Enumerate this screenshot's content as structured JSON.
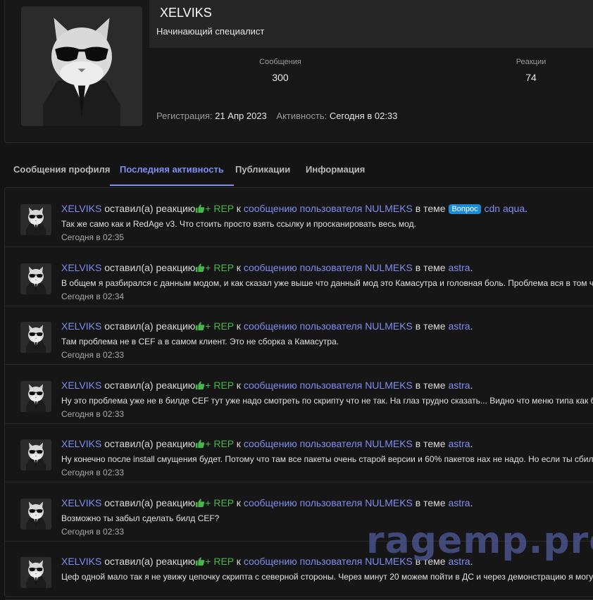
{
  "profile": {
    "username": "XELVIKS",
    "title": "Начинающий специалист",
    "stats": [
      {
        "label": "Сообщения",
        "value": "300"
      },
      {
        "label": "Реакции",
        "value": "74"
      }
    ],
    "registration_label": "Регистрация:",
    "registration_value": "21 Апр 2023",
    "activity_label": "Активность:",
    "activity_value": "Сегодня в 02:33"
  },
  "tabs": [
    {
      "label": "Сообщения профиля",
      "active": false
    },
    {
      "label": "Последняя активность",
      "active": true
    },
    {
      "label": "Публикации",
      "active": false
    },
    {
      "label": "Информация",
      "active": false
    }
  ],
  "feed": [
    {
      "user": "XELVIKS",
      "action": "оставил(а) реакцию",
      "rep": "+ REP",
      "k": "к",
      "target": "сообщению пользователя NULMEKS",
      "in_thread": "в теме",
      "prefix": "Вопрос",
      "thread": "cdn aqua",
      "snippet": "Так же само как и RedAge v3. Что стоить просто взять ссылку и просканировать весь мод.",
      "time": "Сегодня в 02:35"
    },
    {
      "user": "XELVIKS",
      "action": "оставил(а) реакцию",
      "rep": "+ REP",
      "k": "к",
      "target": "сообщению пользователя NULMEKS",
      "in_thread": "в теме",
      "prefix": "",
      "thread": "astra",
      "snippet": "В общем я разбирался с данным модом, и как сказал уже выше что данный мод это Камасутра и головная боль. Проблема вся в том что",
      "time": "Сегодня в 02:34"
    },
    {
      "user": "XELVIKS",
      "action": "оставил(а) реакцию",
      "rep": "+ REP",
      "k": "к",
      "target": "сообщению пользователя NULMEKS",
      "in_thread": "в теме",
      "prefix": "",
      "thread": "astra",
      "snippet": "Там проблема не в CEF а в самом клиент. Это не сборка а Камасутра.",
      "time": "Сегодня в 02:33"
    },
    {
      "user": "XELVIKS",
      "action": "оставил(а) реакцию",
      "rep": "+ REP",
      "k": "к",
      "target": "сообщению пользователя NULMEKS",
      "in_thread": "в теме",
      "prefix": "",
      "thread": "astra",
      "snippet": "Ну это проблема уже не в билде CEF тут уже надо смотреть по скрипту что не так. На глаз трудно сказать... Видно что меню типа как бы.",
      "time": "Сегодня в 02:33"
    },
    {
      "user": "XELVIKS",
      "action": "оставил(а) реакцию",
      "rep": "+ REP",
      "k": "к",
      "target": "сообщению пользователя NULMEKS",
      "in_thread": "в теме",
      "prefix": "",
      "thread": "astra",
      "snippet": "Ну конечно после install смущения будет. Потому что там все пакеты очень старой версии и 60% пакетов нах не надо. Но если ты сбилди",
      "time": "Сегодня в 02:33"
    },
    {
      "user": "XELVIKS",
      "action": "оставил(а) реакцию",
      "rep": "+ REP",
      "k": "к",
      "target": "сообщению пользователя NULMEKS",
      "in_thread": "в теме",
      "prefix": "",
      "thread": "astra",
      "snippet": "Возможно ты забыл сделать билд CEF?",
      "time": "Сегодня в 02:33"
    },
    {
      "user": "XELVIKS",
      "action": "оставил(а) реакцию",
      "rep": "+ REP",
      "k": "к",
      "target": "сообщению пользователя NULMEKS",
      "in_thread": "в теме",
      "prefix": "",
      "thread": "astra",
      "snippet": "Цеф одной мало так я не увижу цепочку скрипта с северной стороны. Через минут 20 можем пойти в ДС и через демонстрацию я могу т",
      "time": ""
    }
  ],
  "icons": {
    "avatar": "cat-with-sunglasses-avatar",
    "reaction": "thumbs-up-icon"
  },
  "colors": {
    "accent": "#7f8cf0",
    "rep": "#47b64a",
    "badge": "#1a8bd6"
  },
  "watermark": "ragemp.pro"
}
